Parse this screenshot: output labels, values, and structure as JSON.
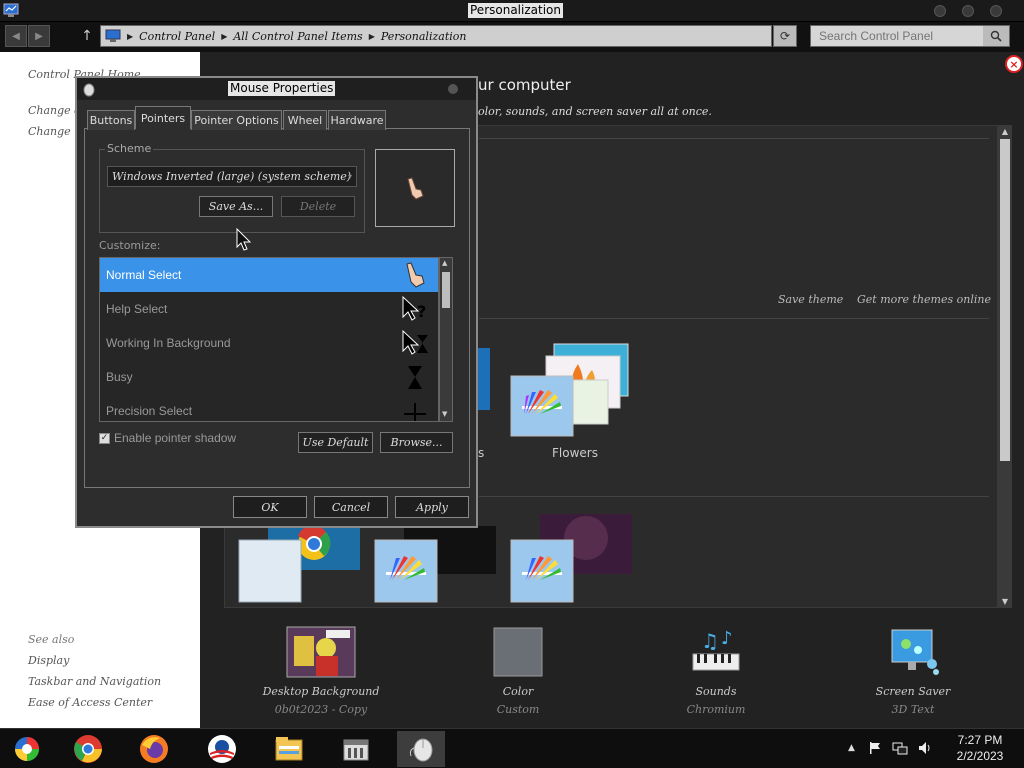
{
  "window": {
    "title": "Personalization"
  },
  "address": {
    "crumbs": [
      "Control Panel",
      "All Control Panel Items",
      "Personalization"
    ],
    "search_placeholder": "Search Control Panel"
  },
  "left_panel": {
    "home": "Control Panel Home",
    "link1": "Change d",
    "link2": "Change m",
    "see_also": "See also",
    "see_also_items": [
      "Display",
      "Taskbar and Navigation",
      "Ease of Access Center"
    ]
  },
  "main": {
    "heading": "ur computer",
    "subheading": "olor, sounds, and screen saver all at once.",
    "save_theme": "Save theme",
    "get_more": "Get more themes online",
    "flowers_label": "Flowers",
    "partial_label": "s",
    "bottom": [
      {
        "name": "Desktop Background",
        "sub": "0b0t2023 - Copy"
      },
      {
        "name": "Color",
        "sub": "Custom"
      },
      {
        "name": "Sounds",
        "sub": "Chromium"
      },
      {
        "name": "Screen Saver",
        "sub": "3D Text"
      }
    ]
  },
  "dialog": {
    "title": "Mouse Properties",
    "tabs": [
      "Buttons",
      "Pointers",
      "Pointer Options",
      "Wheel",
      "Hardware"
    ],
    "active_tab": "Pointers",
    "scheme_label": "Scheme",
    "scheme_value": "Windows Inverted (large) (system scheme)",
    "save_as": "Save As...",
    "delete": "Delete",
    "customize_label": "Customize:",
    "cursors": [
      {
        "name": "Normal Select",
        "icon": "hand-pointer-icon",
        "selected": true
      },
      {
        "name": "Help Select",
        "icon": "help-select-icon",
        "selected": false
      },
      {
        "name": "Working In Background",
        "icon": "working-icon",
        "selected": false
      },
      {
        "name": "Busy",
        "icon": "hourglass-icon",
        "selected": false
      },
      {
        "name": "Precision Select",
        "icon": "crosshair-icon",
        "selected": false
      }
    ],
    "shadow_label": "Enable pointer shadow",
    "shadow_checked": true,
    "use_default": "Use Default",
    "browse": "Browse...",
    "ok": "OK",
    "cancel": "Cancel",
    "apply": "Apply"
  },
  "taskbar": {
    "time": "7:27 PM",
    "date": "2/2/2023",
    "apps": [
      "control-panel-icon",
      "chrome-icon",
      "firefox-icon",
      "obama-logo-icon",
      "file-explorer-icon",
      "store-icon",
      "mouse-icon"
    ]
  },
  "colors": {
    "selection": "#3a93e8",
    "close_red": "#dd2222"
  }
}
